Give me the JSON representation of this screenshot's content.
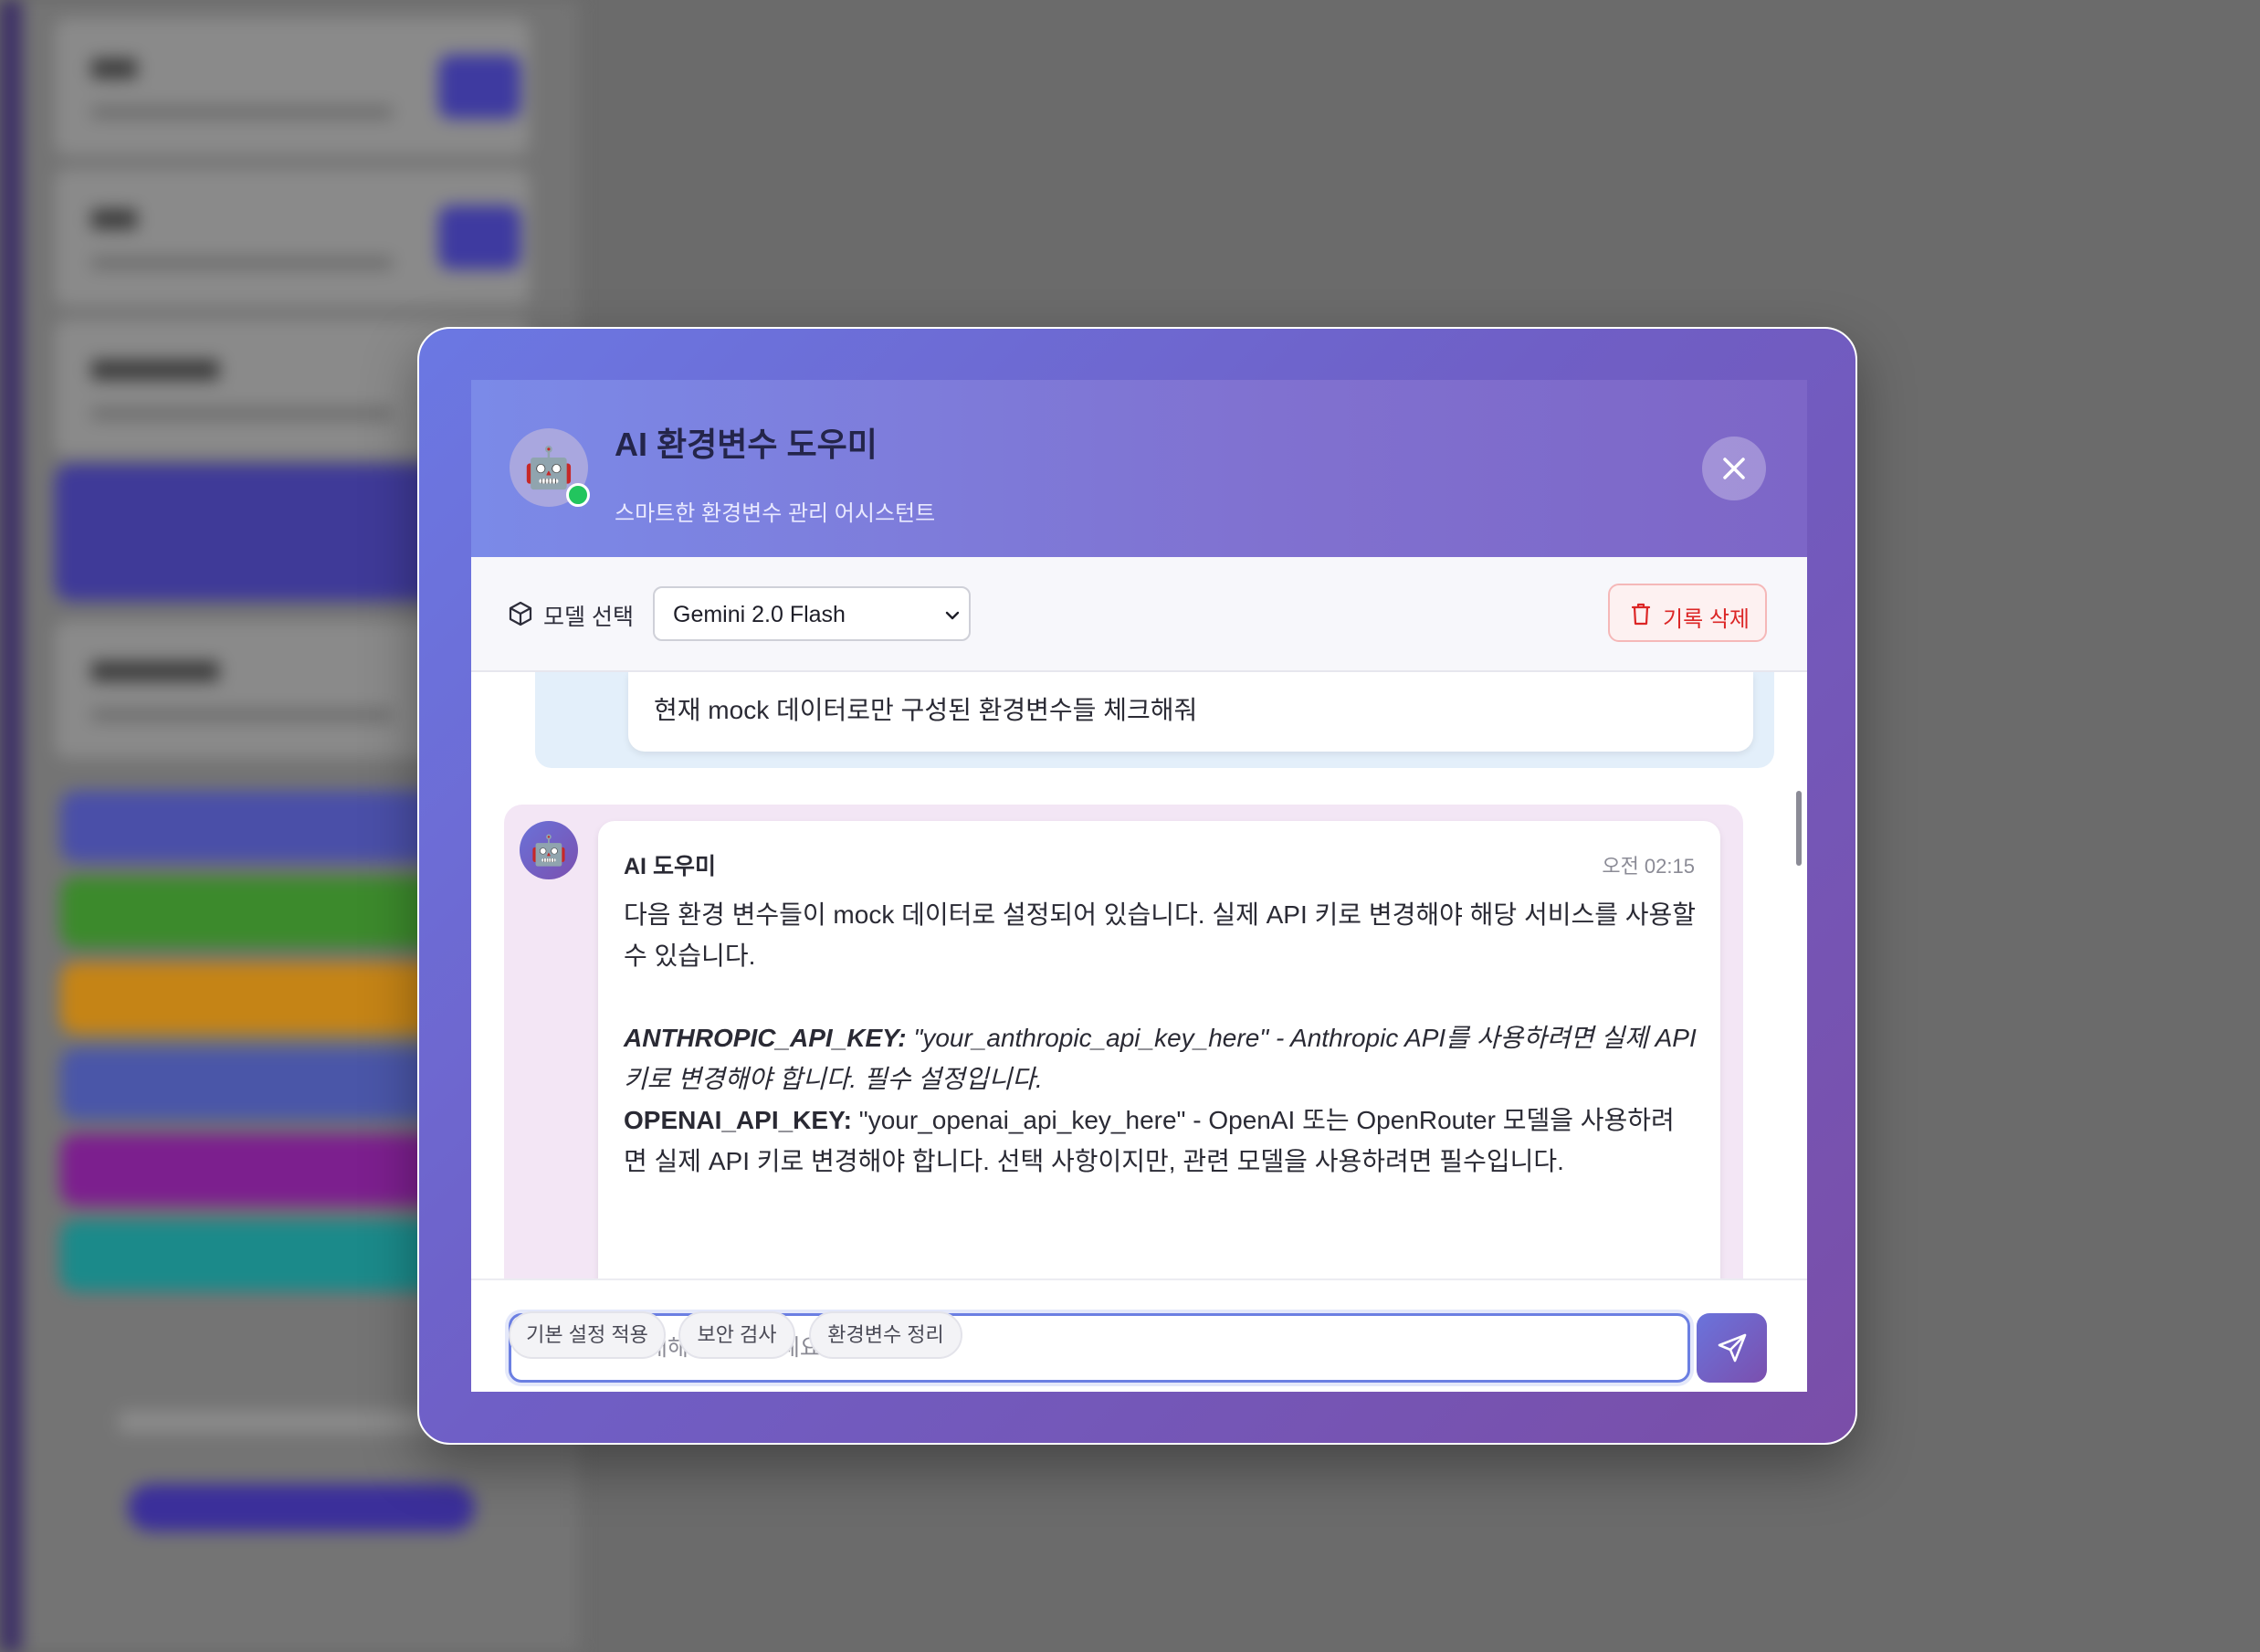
{
  "modal": {
    "title": "AI 환경변수 도우미",
    "subtitle": "스마트한 환경변수 관리 어시스턴트",
    "avatar_icon": "robot-icon",
    "status": "online",
    "close_icon": "close-icon"
  },
  "toolbar": {
    "model_label": "모델 선택",
    "model_selected": "Gemini 2.0 Flash",
    "clear_label": "기록 삭제"
  },
  "messages": {
    "user": {
      "text": "현재 mock 데이터로만 구성된 환경변수들 체크해줘"
    },
    "ai": {
      "sender": "AI 도우미",
      "time": "오전 02:15",
      "intro": "다음 환경 변수들이 mock 데이터로 설정되어 있습니다. 실제 API 키로 변경해야 해당 서비스를 사용할 수 있습니다.",
      "items": [
        {
          "key": "ANTHROPIC_API_KEY:",
          "desc": " \"your_anthropic_api_key_here\" - Anthropic API를 사용하려면 실제 API 키로 변경해야 합니다. 필수 설정입니다."
        },
        {
          "key": "OPENAI_API_KEY:",
          "desc": " \"your_openai_api_key_here\" - OpenAI 또는 OpenRouter 모델을 사용하려면 실제 API 키로 변경해야 합니다. 선택 사항이지만, 관련 모델을 사용하려면 필수입니다."
        }
      ]
    }
  },
  "input": {
    "placeholder": "환경변수에 대해 질문해보세요...",
    "value": ""
  },
  "quick_actions": [
    "기본 설정 적용",
    "보안 검사",
    "환경변수 정리"
  ],
  "colors": {
    "accent": "#6b78e3",
    "accent_end": "#7a4ea8",
    "danger": "#dc2626",
    "online": "#22c55e"
  }
}
